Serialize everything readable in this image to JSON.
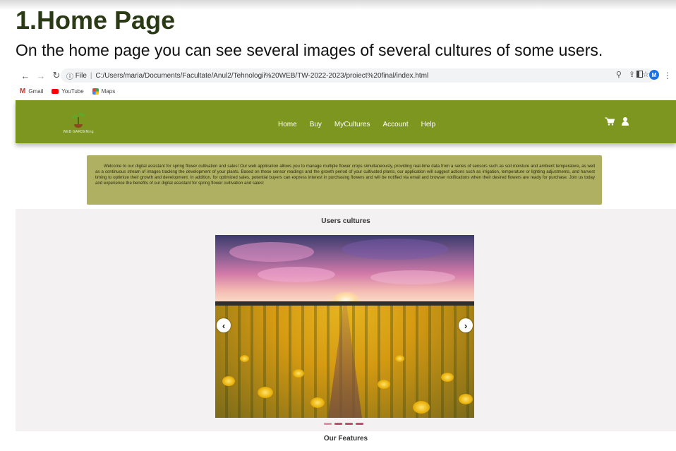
{
  "document": {
    "title": "1.Home Page",
    "subtitle": "On the home page you can see several images of several cultures of some users."
  },
  "browser": {
    "url_prefix": "File",
    "url": "C:/Users/maria/Documents/Facultate/Anul2/Tehnologii%20WEB/TW-2022-2023/proiect%20final/index.html",
    "profile_initial": "M",
    "bookmarks": [
      {
        "label": "Gmail",
        "icon": "gmail-icon"
      },
      {
        "label": "YouTube",
        "icon": "youtube-icon"
      },
      {
        "label": "Maps",
        "icon": "maps-icon"
      }
    ]
  },
  "site": {
    "logo_text": "WEB GARDENing",
    "nav": [
      "Home",
      "Buy",
      "MyCultures",
      "Account",
      "Help"
    ],
    "icons": [
      "cart-icon",
      "user-icon"
    ],
    "welcome_text": "Welcome to our digital assistant for spring flower cultivation and sales! Our web application allows you to manage multiple flower crops simultaneously, providing real-time data from a series of sensors such as soil moisture and ambient temperature, as well as a continuous stream of images tracking the development of your plants. Based on these sensor readings and the growth period of your cultivated plants, our application will suggest actions such as irrigation, temperature or lighting adjustments, and harvest timing to optimize their growth and development. In addition, for optimized sales, potential buyers can express interest in purchasing flowers and will be notified via email and browser notifications when their desired flowers are ready for purchase. Join us today and experience the benefits of our digital assistant for spring flower cultivation and sales!",
    "cultures_title": "Users cultures",
    "carousel": {
      "prev": "‹",
      "next": "›",
      "slide_count": 4,
      "active_index": 0
    },
    "features_title": "Our Features"
  },
  "colors": {
    "nav_bg": "#7d961f",
    "welcome_bg": "#b0b063",
    "section_bg": "#f3f1f1",
    "dot": "#c0506f"
  }
}
